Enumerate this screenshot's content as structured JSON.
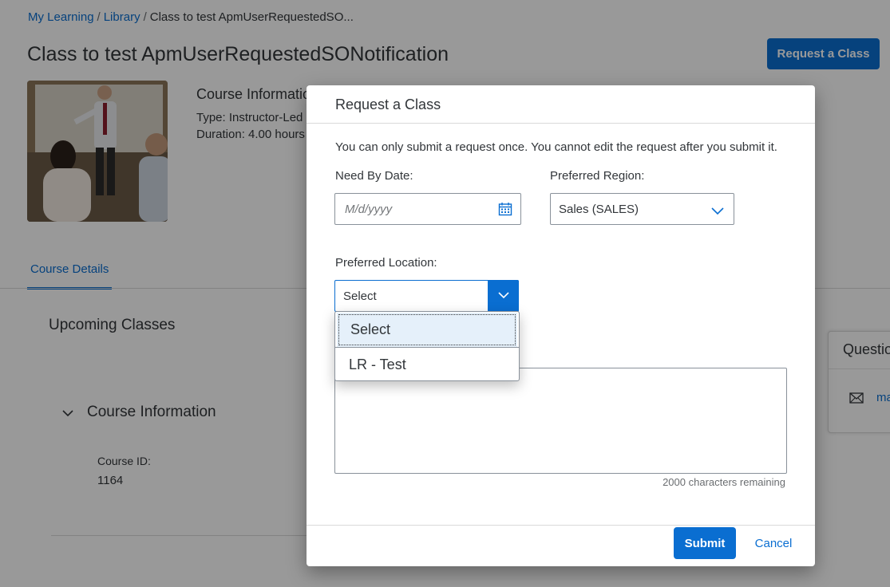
{
  "breadcrumb": {
    "items": [
      "My Learning",
      "Library"
    ],
    "current": "Class to test ApmUserRequestedSO...",
    "separator": "/"
  },
  "page": {
    "title": "Class to test ApmUserRequestedSONotification",
    "request_button": "Request a Class"
  },
  "course_info": {
    "title": "Course Informatio",
    "type": "Type: Instructor-Led",
    "duration": "Duration: 4.00 hours"
  },
  "tabs": [
    "Course Details"
  ],
  "sections": {
    "upcoming_title": "Upcoming Classes",
    "course_info_title": "Course Information",
    "course_id_label": "Course ID:",
    "course_id_value": "1164"
  },
  "questions": {
    "title": "Questio",
    "link": "ma"
  },
  "dialog": {
    "title": "Request a Class",
    "notice": "You can only submit a request once. You cannot edit the request after you submit it.",
    "need_by_label": "Need By Date:",
    "date_placeholder": "M/d/yyyy",
    "region_label": "Preferred Region:",
    "region_value": "Sales (SALES)",
    "location_label": "Preferred Location:",
    "location_value": "Select",
    "location_options": [
      "Select",
      "LR - Test"
    ],
    "chars_remaining": "2000 characters remaining",
    "submit_label": "Submit",
    "cancel_label": "Cancel"
  },
  "icons": {
    "date_picker": "calendar-icon",
    "region_dropdown": "chevron-down-icon",
    "location_dropdown": "chevron-down-icon",
    "section_toggle": "chevron-down-icon",
    "contact": "mail-icon"
  },
  "colors": {
    "accent": "#0a6ed1",
    "text": "#32363a",
    "selected_option_bg": "#e5f0fa"
  }
}
